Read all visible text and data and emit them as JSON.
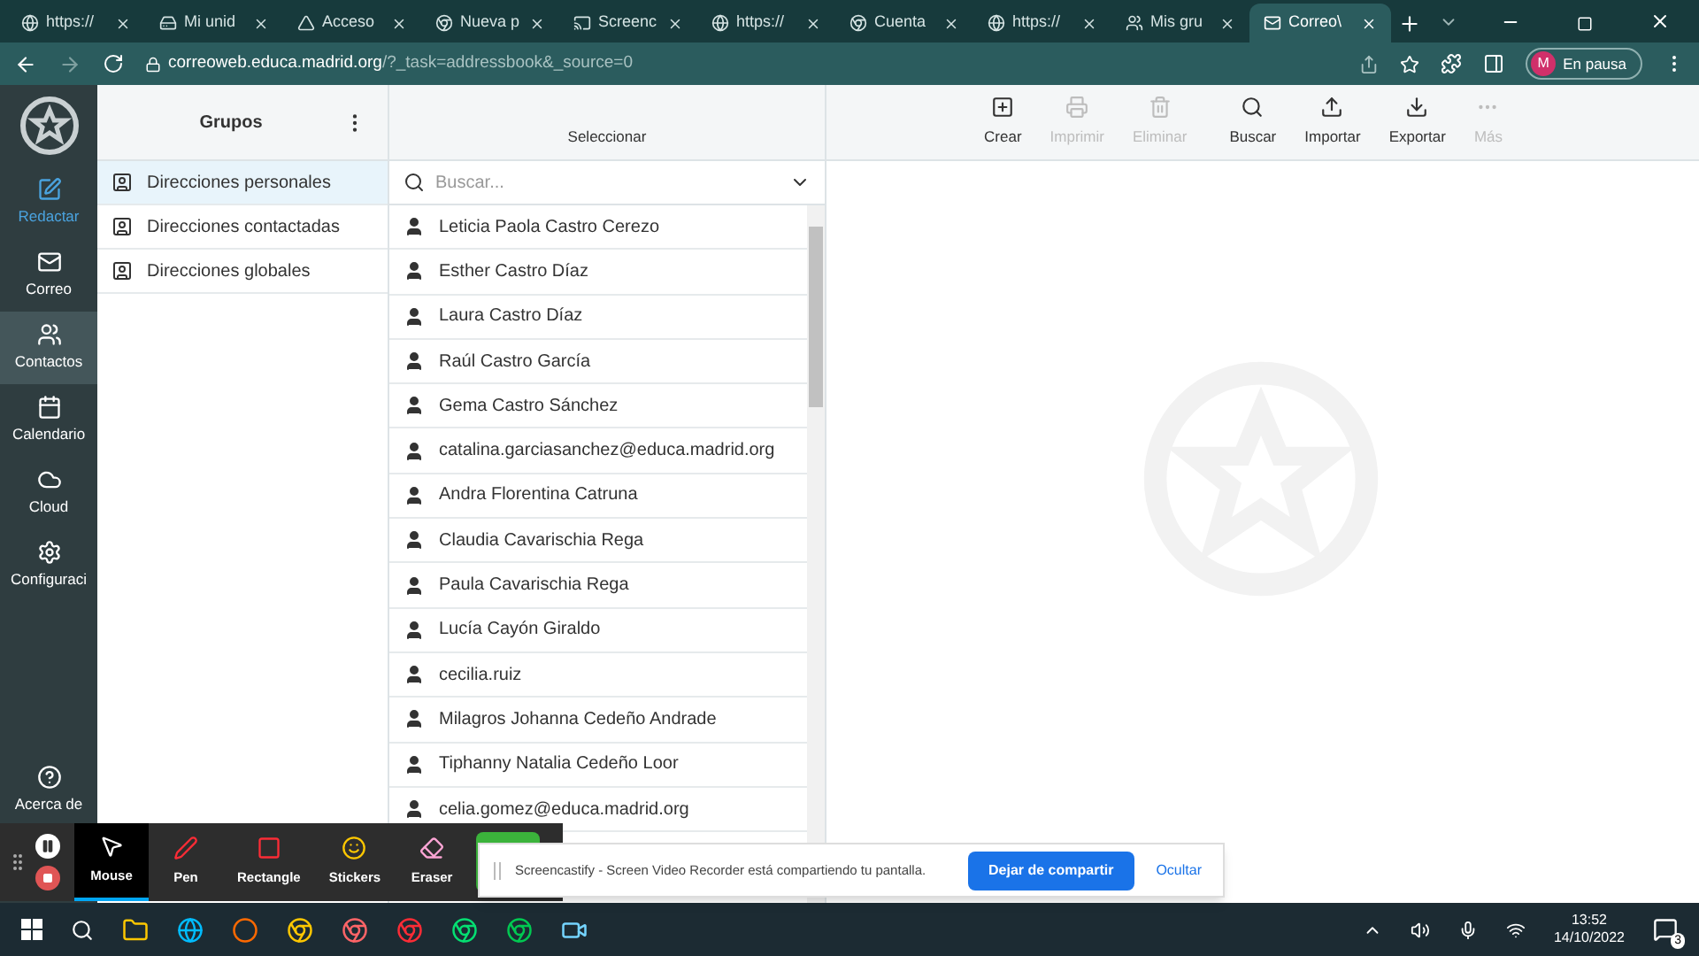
{
  "browser": {
    "tabs": [
      {
        "label": "https://",
        "selected": false,
        "kind": "globe"
      },
      {
        "label": "Mi unid",
        "selected": false,
        "kind": "drive"
      },
      {
        "label": "Acceso",
        "selected": false,
        "kind": "triangle"
      },
      {
        "label": "Nueva p",
        "selected": false,
        "kind": "chrome"
      },
      {
        "label": "Screenc",
        "selected": false,
        "kind": "cast"
      },
      {
        "label": "https://",
        "selected": false,
        "kind": "globe"
      },
      {
        "label": "Cuenta",
        "selected": false,
        "kind": "chrome"
      },
      {
        "label": "https://",
        "selected": false,
        "kind": "globe"
      },
      {
        "label": "Mis gru",
        "selected": false,
        "kind": "people"
      },
      {
        "label": "Correo\\",
        "selected": true,
        "kind": "mail"
      }
    ],
    "url_host": "correoweb.educa.madrid.org",
    "url_path": "/?_task=addressbook&_source=0",
    "profile": {
      "initial": "M",
      "status": "En pausa"
    }
  },
  "nav": [
    {
      "label": "Redactar",
      "selected": false,
      "kind": "compose"
    },
    {
      "label": "Correo",
      "selected": false,
      "kind": "mail"
    },
    {
      "label": "Contactos",
      "selected": true,
      "kind": "contacts"
    },
    {
      "label": "Calendario",
      "selected": false,
      "kind": "calendar"
    },
    {
      "label": "Cloud",
      "selected": false,
      "kind": "cloud"
    },
    {
      "label": "Configuraci",
      "selected": false,
      "kind": "settings"
    }
  ],
  "nav_bottom": {
    "label": "Acerca de"
  },
  "groups": {
    "title": "Grupos",
    "items": [
      {
        "label": "Direcciones personales",
        "selected": true
      },
      {
        "label": "Direcciones contactadas",
        "selected": false
      },
      {
        "label": "Direcciones globales",
        "selected": false
      }
    ]
  },
  "contacts": {
    "select_label": "Seleccionar",
    "search_placeholder": "Buscar...",
    "items": [
      "Leticia Paola Castro Cerezo",
      "Esther Castro Díaz",
      "Laura Castro Díaz",
      "Raúl Castro García",
      "Gema Castro Sánchez",
      "catalina.garciasanchez@educa.madrid.org",
      "Andra Florentina Catruna",
      "Claudia Cavarischia Rega",
      "Paula Cavarischia Rega",
      "Lucía Cayón Giraldo",
      "cecilia.ruiz",
      "Milagros Johanna Cedeño Andrade",
      "Tiphanny Natalia Cedeño Loor",
      "celia.gomez@educa.madrid.org"
    ]
  },
  "toolbar": [
    {
      "label": "Crear",
      "disabled": false,
      "kind": "create"
    },
    {
      "label": "Imprimir",
      "disabled": true,
      "kind": "print"
    },
    {
      "label": "Eliminar",
      "disabled": true,
      "kind": "delete"
    },
    {
      "label": "Buscar",
      "disabled": false,
      "kind": "search"
    },
    {
      "label": "Importar",
      "disabled": false,
      "kind": "import"
    },
    {
      "label": "Exportar",
      "disabled": false,
      "kind": "export"
    },
    {
      "label": "Más",
      "disabled": true,
      "kind": "more"
    }
  ],
  "recorder": {
    "tools": [
      {
        "label": "Mouse",
        "selected": true,
        "kind": "mouse"
      },
      {
        "label": "Pen",
        "selected": false,
        "kind": "pen"
      },
      {
        "label": "Rectangle",
        "selected": false,
        "kind": "rect"
      },
      {
        "label": "Stickers",
        "selected": false,
        "kind": "sticker"
      },
      {
        "label": "Eraser",
        "selected": false,
        "kind": "eraser"
      }
    ]
  },
  "share_bar": {
    "message": "Screencastify - Screen Video Recorder está compartiendo tu pantalla.",
    "stop": "Dejar de compartir",
    "hide": "Ocultar"
  },
  "taskbar": {
    "time": "13:52",
    "date": "14/10/2022",
    "notifications": "3"
  }
}
